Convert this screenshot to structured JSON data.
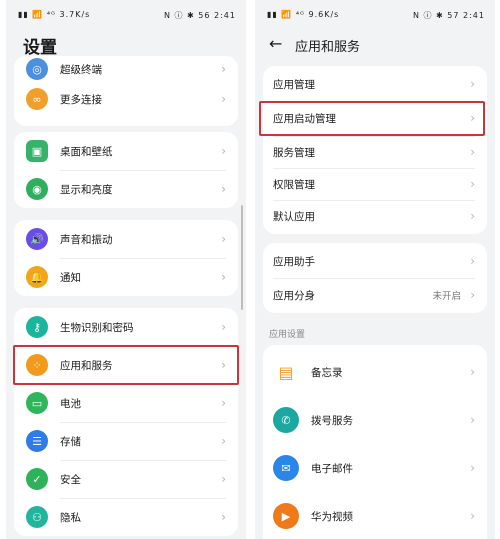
{
  "left": {
    "status_left": "▮▮ 📶 ⁴ᴳ 3.7K/s",
    "status_right": "N ⓘ ✱ 56 2:41",
    "title": "设置",
    "groups": [
      {
        "items": [
          {
            "label": "超级终端",
            "icon": "super-device-icon"
          },
          {
            "label": "更多连接",
            "icon": "link-icon"
          }
        ]
      },
      {
        "items": [
          {
            "label": "桌面和壁纸",
            "icon": "wallpaper-icon"
          },
          {
            "label": "显示和亮度",
            "icon": "eye-icon"
          }
        ]
      },
      {
        "items": [
          {
            "label": "声音和振动",
            "icon": "speaker-icon"
          },
          {
            "label": "通知",
            "icon": "bell-icon"
          }
        ]
      },
      {
        "items": [
          {
            "label": "生物识别和密码",
            "icon": "key-icon"
          },
          {
            "label": "应用和服务",
            "icon": "apps-icon"
          },
          {
            "label": "电池",
            "icon": "battery-icon"
          },
          {
            "label": "存储",
            "icon": "storage-icon"
          },
          {
            "label": "安全",
            "icon": "shield-icon"
          },
          {
            "label": "隐私",
            "icon": "privacy-icon"
          }
        ]
      }
    ]
  },
  "right": {
    "status_left": "▮▮ 📶 ⁴ᴳ 9.6K/s",
    "status_right": "N ⓘ ✱ 57 2:41",
    "title": "应用和服务",
    "group1": [
      "应用管理",
      "应用启动管理",
      "服务管理",
      "权限管理",
      "默认应用"
    ],
    "group2": [
      {
        "label": "应用助手",
        "value": ""
      },
      {
        "label": "应用分身",
        "value": "未开启"
      }
    ],
    "section_label": "应用设置",
    "apps": [
      {
        "label": "备忘录",
        "icon": "memo-icon"
      },
      {
        "label": "拨号服务",
        "icon": "phone-icon"
      },
      {
        "label": "电子邮件",
        "icon": "mail-icon"
      },
      {
        "label": "华为视频",
        "icon": "video-icon"
      }
    ]
  },
  "colors": {
    "highlight": "#c9353b",
    "background": "#f1f3f5"
  }
}
